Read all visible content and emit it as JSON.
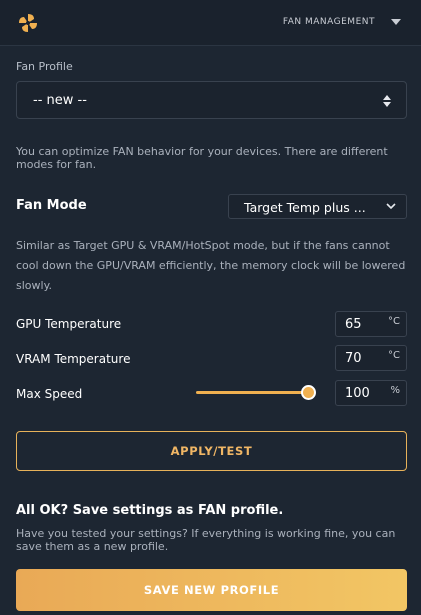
{
  "header": {
    "title": "FAN MANAGEMENT",
    "logo_icon": "pinwheel-icon",
    "accent": "#f0b050"
  },
  "profile": {
    "label": "Fan Profile",
    "selected": "-- new --"
  },
  "intro_text": "You can optimize FAN behavior for your devices. There are different modes for fan.",
  "mode": {
    "label": "Fan Mode",
    "selected": "Target Temp plus ...",
    "description": "Similar as Target GPU & VRAM/HotSpot mode, but if the fans cannot cool down the GPU/VRAM efficiently, the memory clock will be lowered slowly."
  },
  "fields": {
    "gpu_temp": {
      "label": "GPU Temperature",
      "value": "65",
      "unit": "°C"
    },
    "vram_temp": {
      "label": "VRAM Temperature",
      "value": "70",
      "unit": "°C"
    },
    "max_speed": {
      "label": "Max Speed",
      "value": "100",
      "unit": "%",
      "slider_fraction": 1.0
    }
  },
  "apply_label": "APPLY/TEST",
  "save_section": {
    "title": "All OK? Save settings as FAN profile.",
    "text": "Have you tested your settings? If everything is working fine, you can save them as a new profile.",
    "button": "SAVE NEW PROFILE"
  }
}
